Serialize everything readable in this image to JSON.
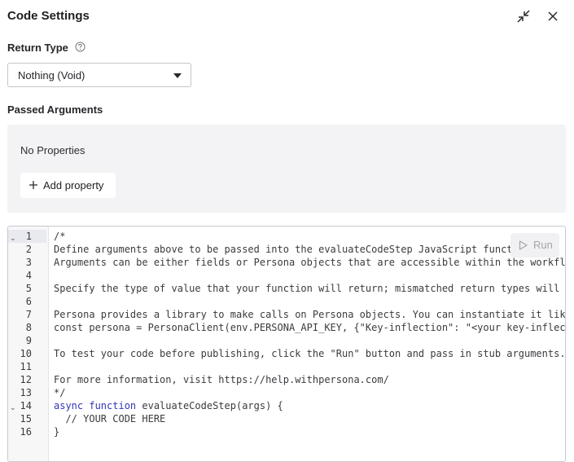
{
  "header": {
    "title": "Code Settings",
    "icons": [
      "minimize-icon",
      "close-icon"
    ]
  },
  "return_type": {
    "label": "Return Type",
    "help_icon": "question-circle-icon",
    "selected_value": "Nothing (Void)"
  },
  "passed_arguments": {
    "label": "Passed Arguments",
    "empty_text": "No Properties",
    "add_button_label": "Add property"
  },
  "editor": {
    "run_button_label": "Run",
    "line_numbers": [
      "1",
      "2",
      "3",
      "4",
      "5",
      "6",
      "7",
      "8",
      "9",
      "10",
      "11",
      "12",
      "13",
      "14",
      "15",
      "16"
    ],
    "lines": [
      "/*",
      "Define arguments above to be passed into the evaluateCodeStep JavaScript funct",
      "Arguments can be either fields or Persona objects that are accessible within the workflo",
      "",
      "Specify the type of value that your function will return; mismatched return types will c",
      "",
      "Persona provides a library to make calls on Persona objects. You can instantiate it like",
      "const persona = PersonaClient(env.PERSONA_API_KEY, {\"Key-inflection\": \"<your key-inflect",
      "",
      "To test your code before publishing, click the \"Run\" button and pass in stub arguments.",
      "",
      "For more information, visit https://help.withpersona.com/",
      "*/",
      "",
      "  // YOUR CODE HERE",
      "}"
    ],
    "line14_parts": {
      "kw1": "async",
      "kw2": "function",
      "rest": " evaluateCodeStep(args) {"
    },
    "colors": {
      "keyword": "#3236b8",
      "comment": "#5d5d66"
    }
  }
}
